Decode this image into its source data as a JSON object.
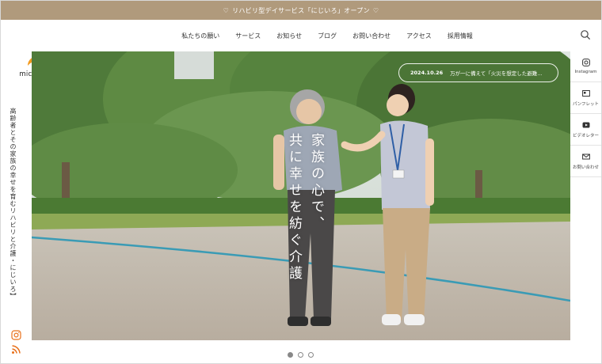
{
  "announcement": {
    "text": "リハビリ型デイサービス「にじいろ」オープン",
    "heart_icon": "heart-outline-icon"
  },
  "nav": {
    "items": [
      {
        "label": "私たちの願い"
      },
      {
        "label": "サービス"
      },
      {
        "label": "お知らせ"
      },
      {
        "label": "ブログ"
      },
      {
        "label": "お問い合わせ"
      },
      {
        "label": "アクセス"
      },
      {
        "label": "採用情報"
      }
    ],
    "search_icon": "search-icon"
  },
  "logo": {
    "text": "michishirube",
    "color": "#f39a1e"
  },
  "left_rail": {
    "tagline": "高齢者とその家族の幸せを育むリハビリと介護・にじいろ】",
    "icons": [
      "instagram-icon",
      "rss-icon"
    ],
    "accent": "#e8701a"
  },
  "hero": {
    "news": {
      "date": "2024.10.26",
      "text": "万が一に備えて「火災を想定した避難…"
    },
    "catch_line1": "家族の心で、",
    "catch_line2": "共に幸せを紡ぐ介護"
  },
  "right_rail": {
    "items": [
      {
        "label": "Instagram",
        "icon": "instagram-icon"
      },
      {
        "label": "パンフレット",
        "icon": "brochure-icon"
      },
      {
        "label": "ビデオレター",
        "icon": "video-icon"
      },
      {
        "label": "お問い合わせ",
        "icon": "mail-icon"
      }
    ]
  },
  "slider": {
    "count": 3,
    "active_index": 0
  },
  "colors": {
    "announcement_bg": "#b09a7c",
    "accent_orange": "#f39a1e"
  }
}
